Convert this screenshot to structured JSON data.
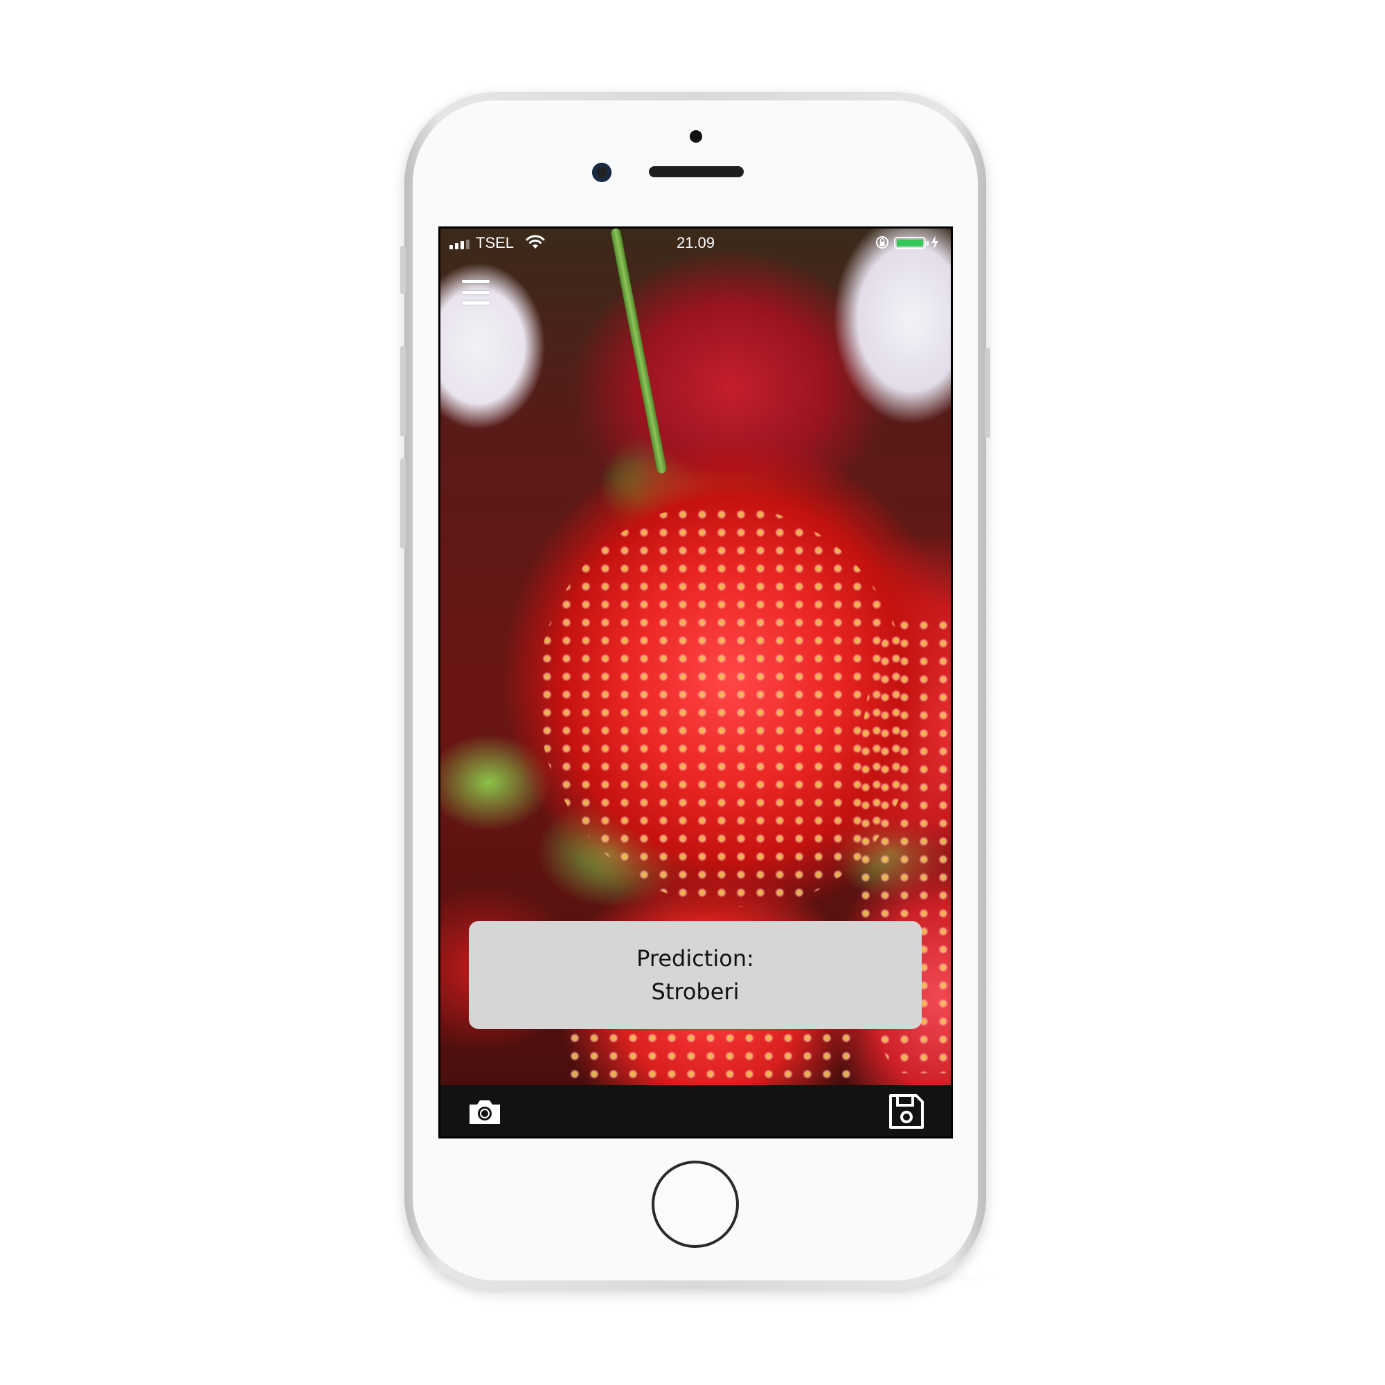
{
  "status_bar": {
    "carrier": "TSEL",
    "time": "21.09",
    "signal_bars": 3,
    "battery_level": 1.0,
    "battery_color": "#34c759",
    "charging": true
  },
  "menu": {
    "icon": "hamburger-menu-icon"
  },
  "prediction": {
    "label": "Prediction:",
    "value": "Stroberi"
  },
  "toolbar": {
    "camera_icon": "camera-icon",
    "save_icon": "floppy-disk-save-icon"
  },
  "colors": {
    "card_background": "#d6d6d6",
    "toolbar_background": "#121212"
  }
}
